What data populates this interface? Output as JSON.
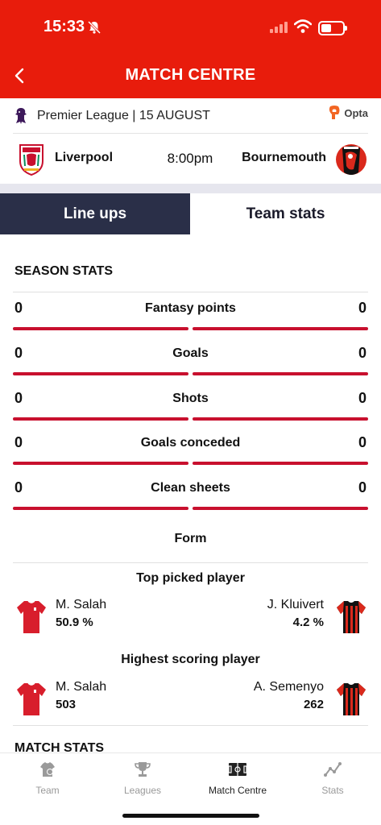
{
  "status": {
    "time": "15:33"
  },
  "header": {
    "title": "MATCH CENTRE"
  },
  "league": {
    "text": "Premier League | 15 AUGUST",
    "provider": "Opta"
  },
  "match": {
    "home": "Liverpool",
    "kickoff": "8:00pm",
    "away": "Bournemouth"
  },
  "tabs": {
    "lineups": "Line ups",
    "team_stats": "Team stats"
  },
  "season_stats": {
    "title": "SEASON STATS",
    "rows": [
      {
        "label": "Fantasy points",
        "home": "0",
        "away": "0"
      },
      {
        "label": "Goals",
        "home": "0",
        "away": "0"
      },
      {
        "label": "Shots",
        "home": "0",
        "away": "0"
      },
      {
        "label": "Goals conceded",
        "home": "0",
        "away": "0"
      },
      {
        "label": "Clean sheets",
        "home": "0",
        "away": "0"
      }
    ]
  },
  "form": {
    "title": "Form"
  },
  "top_picked": {
    "title": "Top picked player",
    "home": {
      "name": "M. Salah",
      "value": "50.9 %"
    },
    "away": {
      "name": "J. Kluivert",
      "value": "4.2 %"
    }
  },
  "highest_scoring": {
    "title": "Highest scoring player",
    "home": {
      "name": "M. Salah",
      "value": "503"
    },
    "away": {
      "name": "A. Semenyo",
      "value": "262"
    }
  },
  "match_stats": {
    "title": "MATCH STATS"
  },
  "tabbar": {
    "items": [
      {
        "label": "Team",
        "icon": "team-icon"
      },
      {
        "label": "Leagues",
        "icon": "trophy-icon"
      },
      {
        "label": "Match Centre",
        "icon": "pitch-icon"
      },
      {
        "label": "Stats",
        "icon": "chart-icon"
      }
    ]
  },
  "colors": {
    "brand": "#e81c0c",
    "bar": "#c8102e",
    "tab_active": "#2a2f48"
  }
}
